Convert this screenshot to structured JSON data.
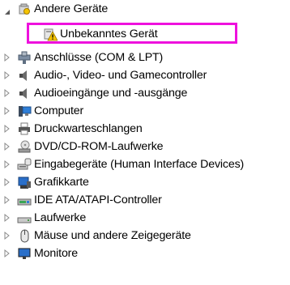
{
  "tree": {
    "category": {
      "label": "Andere Geräte",
      "expanded": true,
      "children": [
        {
          "label": "Unbekanntes Gerät",
          "icon": "unknown-device-warning-icon"
        }
      ]
    },
    "categories": [
      {
        "label": "Anschlüsse (COM & LPT)",
        "icon": "port-connector-icon"
      },
      {
        "label": "Audio-, Video- und Gamecontroller",
        "icon": "speaker-icon"
      },
      {
        "label": "Audioeingänge und -ausgänge",
        "icon": "speaker-icon"
      },
      {
        "label": "Computer",
        "icon": "computer-icon"
      },
      {
        "label": "Druckwarteschlangen",
        "icon": "printer-icon"
      },
      {
        "label": "DVD/CD-ROM-Laufwerke",
        "icon": "dvd-drive-icon"
      },
      {
        "label": "Eingabegeräte (Human Interface Devices)",
        "icon": "hid-device-icon"
      },
      {
        "label": "Grafikkarte",
        "icon": "graphics-card-icon"
      },
      {
        "label": "IDE ATA/ATAPI-Controller",
        "icon": "ide-controller-icon"
      },
      {
        "label": "Laufwerke",
        "icon": "disk-drive-icon"
      },
      {
        "label": "Mäuse und andere Zeigegeräte",
        "icon": "mouse-icon"
      },
      {
        "label": "Monitore",
        "icon": "monitor-icon"
      }
    ]
  },
  "colors": {
    "highlight_border": "#ee11dd",
    "expander_arrow": "#8a8a8a",
    "warning": "#f5c400"
  }
}
